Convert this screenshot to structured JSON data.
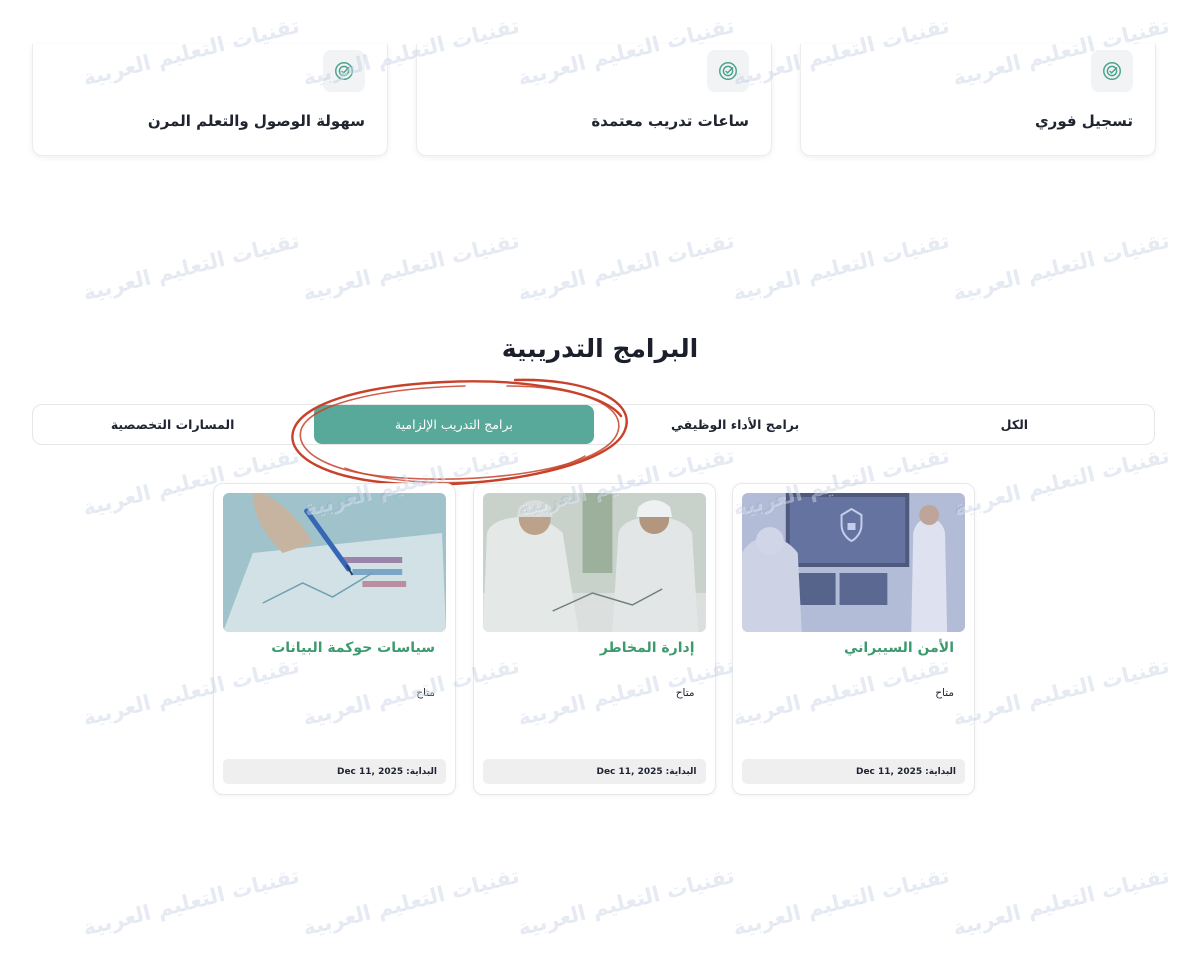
{
  "features": [
    {
      "title": "تسجيل فوري",
      "icon": "target-check-icon"
    },
    {
      "title": "ساعات تدريب معتمدة",
      "icon": "target-check-icon"
    },
    {
      "title": "سهولة الوصول والتعلم المرن",
      "icon": "target-check-icon"
    }
  ],
  "section": {
    "title": "البرامج التدريبية"
  },
  "tabs": [
    {
      "label": "الكل",
      "active": false
    },
    {
      "label": "برامج الأداء الوظيفي",
      "active": false
    },
    {
      "label": "برامج التدريب الإلزامية",
      "active": true
    },
    {
      "label": "المسارات التخصصية",
      "active": false
    }
  ],
  "courses": [
    {
      "title": "الأمن السيبراني",
      "status": "متاح",
      "date_label": "البداية:",
      "date_value": "Dec 11, 2025",
      "image": "cybersecurity-photo"
    },
    {
      "title": "إدارة المخاطر",
      "status": "متاح",
      "date_label": "البداية:",
      "date_value": "Dec 11, 2025",
      "image": "risk-management-photo"
    },
    {
      "title": "سياسات حوكمة البيانات",
      "status": "متاح",
      "date_label": "البداية:",
      "date_value": "Dec 11, 2025",
      "image": "data-governance-photo"
    }
  ],
  "watermark": {
    "text": "تقنيات التعليم العربية"
  },
  "colors": {
    "accent": "#58a99a",
    "course_title": "#3d9a6f",
    "scribble": "#c8422b"
  }
}
